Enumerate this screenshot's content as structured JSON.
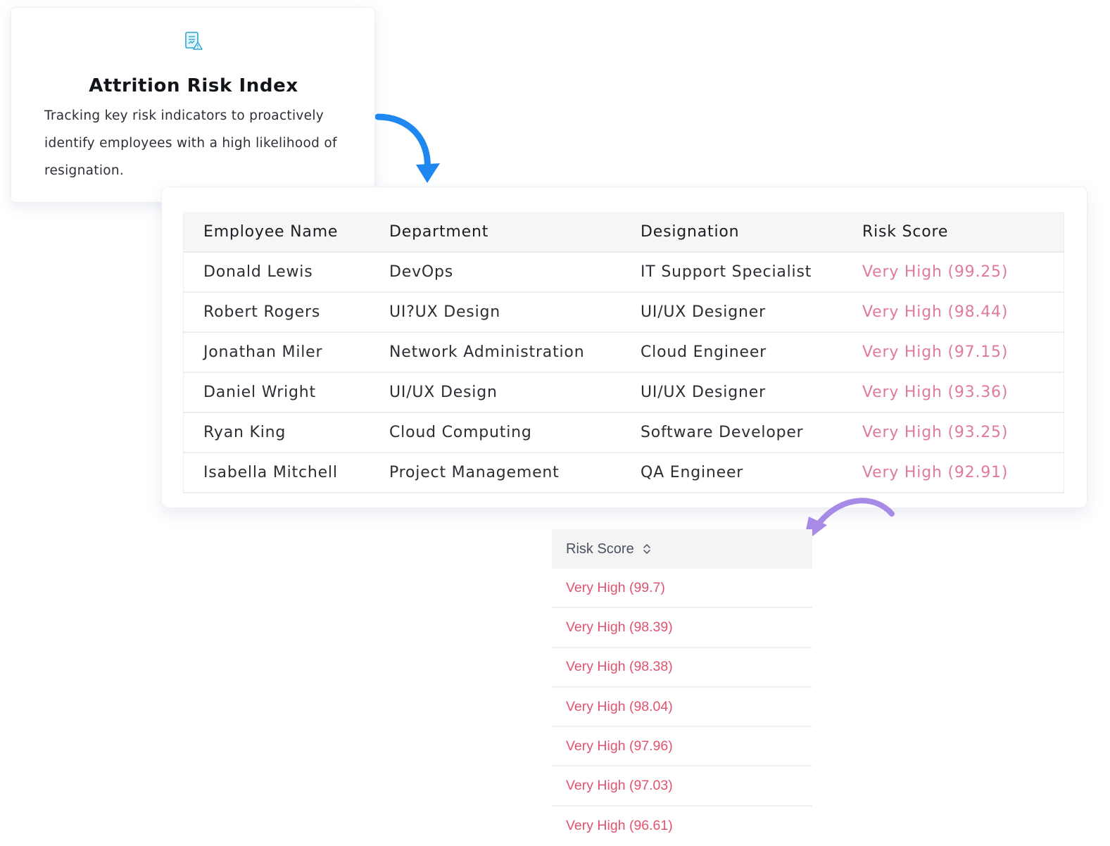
{
  "info_card": {
    "title": "Attrition Risk Index",
    "description": "Tracking key risk indicators to proactively identify employees with a high likelihood of resignation.",
    "icon": "report-alert-icon",
    "icon_color": "#2aa7d6"
  },
  "table": {
    "headers": [
      "Employee Name",
      "Department",
      "Designation",
      "Risk Score"
    ],
    "rows": [
      {
        "name": "Donald Lewis",
        "department": "DevOps",
        "designation": "IT Support Specialist",
        "risk": "Very High (99.25)"
      },
      {
        "name": "Robert Rogers",
        "department": "UI?UX Design",
        "designation": "UI/UX Designer",
        "risk": "Very High (98.44)"
      },
      {
        "name": "Jonathan Miler",
        "department": "Network Administration",
        "designation": "Cloud Engineer",
        "risk": "Very High (97.15)"
      },
      {
        "name": "Daniel Wright",
        "department": "UI/UX Design",
        "designation": "UI/UX Designer",
        "risk": "Very High (93.36)"
      },
      {
        "name": "Ryan King",
        "department": "Cloud Computing",
        "designation": "Software Developer",
        "risk": "Very High (93.25)"
      },
      {
        "name": "Isabella Mitchell",
        "department": "Project Management",
        "designation": "QA Engineer",
        "risk": "Very High (92.91)"
      }
    ]
  },
  "score_column": {
    "header": "Risk Score",
    "sort_icon": "sort-updown-icon",
    "values": [
      "Very High (99.7)",
      "Very High (98.39)",
      "Very High (98.38)",
      "Very High (98.04)",
      "Very High (97.96)",
      "Very High (97.03)",
      "Very High (96.61)"
    ]
  },
  "colors": {
    "risk_text": "#e07a9b",
    "risk_text_snippet": "#e0536f",
    "arrow_blue": "#1f87f0",
    "arrow_purple": "#a68ae6"
  }
}
